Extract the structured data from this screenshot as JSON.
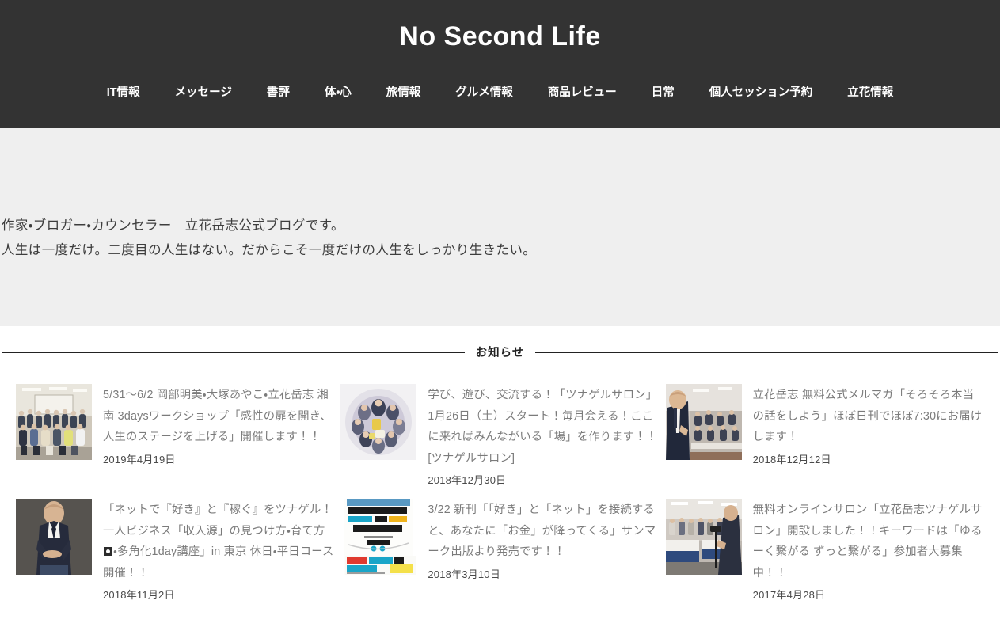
{
  "header": {
    "site_title": "No Second Life",
    "background_color": "#333333",
    "nav_items": [
      {
        "label": "IT情報"
      },
      {
        "label": "メッセージ"
      },
      {
        "label": "書評"
      },
      {
        "label": "体・心"
      },
      {
        "label": "旅情報"
      },
      {
        "label": "グルメ情報"
      },
      {
        "label": "商品レビュー"
      },
      {
        "label": "日常"
      },
      {
        "label": "個人セッション予約"
      },
      {
        "label": "立花情報"
      }
    ]
  },
  "hero": {
    "background_color": "#efefef",
    "description_line_1": "作家・ブロガー・カウンセラー　立花岳志公式ブログです。",
    "description_line_2": "人生は一度だけ。二度目の人生はない。だからこそ一度だけの人生をしっかり生きたい。"
  },
  "news": {
    "section_title": "お知らせ",
    "items": [
      {
        "title": "5/31〜6/2 岡部明美・大塚あやこ・立花岳志 湘南 3daysワークショップ「感性の扉を開き、人生のステージを上げる」開催します！！",
        "date": "2019年4月19日",
        "thumbnail": "group-photo-seminar-room"
      },
      {
        "title": "学び、遊び、交流する！「ツナゲルサロン」1月26日（土）スタート！毎月会える！ここに来ればみんながいる「場」を作ります！！[ツナゲルサロン]",
        "date": "2018年12月30日",
        "thumbnail": "circular-group-photo"
      },
      {
        "title": "立花岳志 無料公式メルマガ「そろそろ本当の話をしよう」ほぼ日刊でほぼ7:30にお届けします！",
        "date": "2018年12月12日",
        "thumbnail": "speaker-at-seminar"
      },
      {
        "title_prefix": "「ネットで『好き』と『稼ぐ』をツナゲル！ 一人ビジネス「収入源」の見つけ方・育て方",
        "title_suffix": "・多角化1day講座」in 東京 休日・平日コース開催！！",
        "title": "「ネットで『好き』と『稼ぐ』をツナゲル！ 一人ビジネス「収入源」の見つけ方・育て方▯・多角化1day講座」in 東京 休日・平日コース開催！！",
        "date": "2018年11月2日",
        "thumbnail": "portrait-man-jacket"
      },
      {
        "title": "3/22 新刊「「好き」と「ネット」を接続すると、あなたに「お金」が降ってくる」サンマーク出版より発売です！！",
        "date": "2018年3月10日",
        "thumbnail": "book-cover"
      },
      {
        "title": "無料オンラインサロン「立花岳志ツナゲルサロン」開設しました！！キーワードは「ゆるーく繋がる ずっと繋がる」参加者大募集中！！",
        "date": "2017年4月28日",
        "thumbnail": "conference-hall"
      }
    ]
  },
  "colors": {
    "header_bg": "#333333",
    "hero_bg": "#efefef",
    "body_bg": "#ffffff",
    "news_title_text": "#7b7b7b",
    "news_date_text": "#4a4a4a",
    "rule": "#222222"
  }
}
